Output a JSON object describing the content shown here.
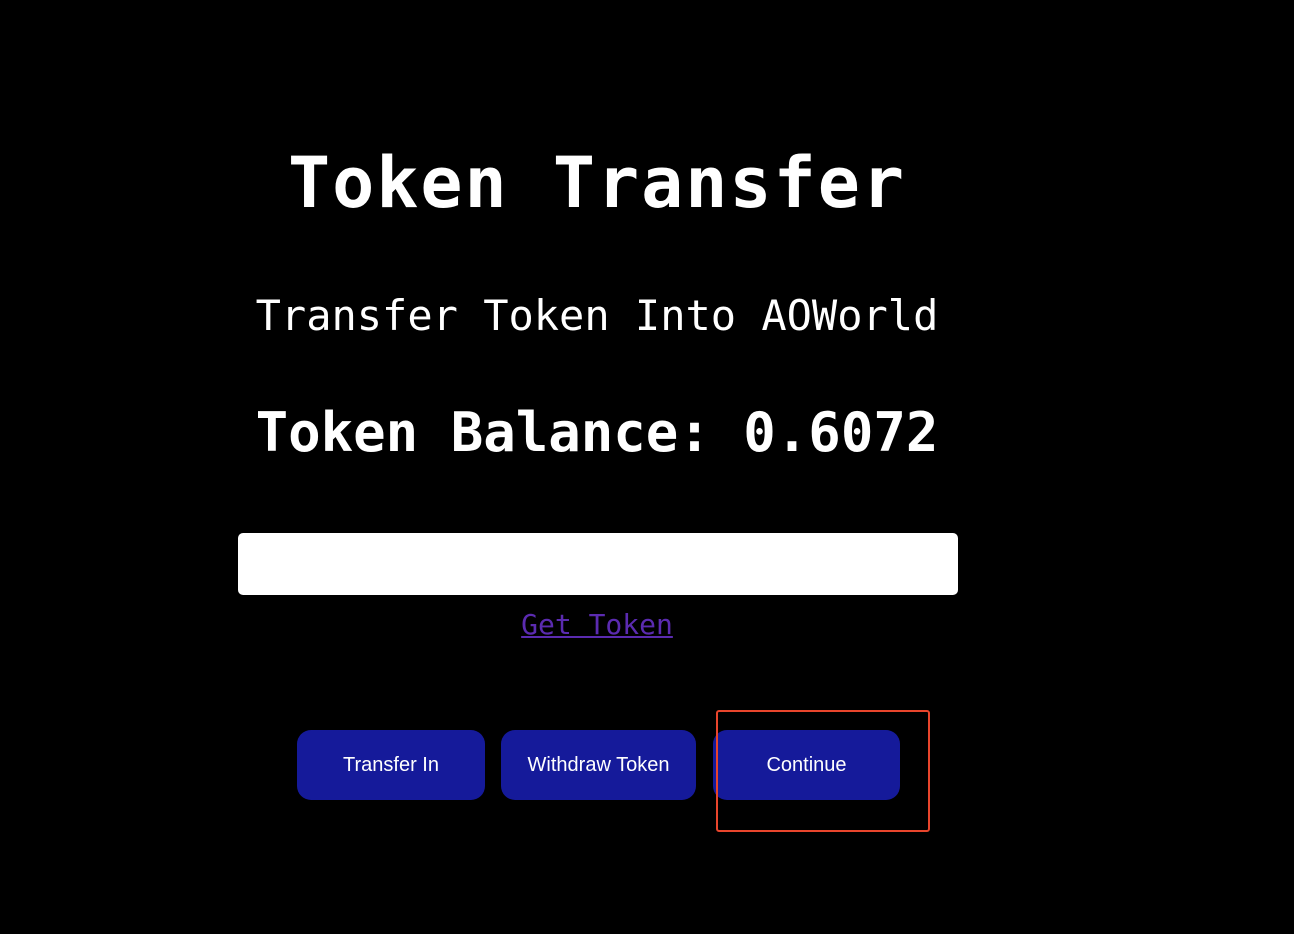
{
  "page": {
    "title": "Token Transfer",
    "subtitle": "Transfer Token Into AOWorld",
    "balance_text": "Token Balance: 0.6072"
  },
  "form": {
    "amount_value": "",
    "amount_placeholder": "",
    "get_token_link": "Get Token"
  },
  "buttons": {
    "transfer_in": "Transfer In",
    "withdraw_token": "Withdraw Token",
    "continue": "Continue"
  },
  "colors": {
    "background": "#000000",
    "button": "#151a9a",
    "link": "#5b2bb0",
    "highlight": "#e8452c"
  }
}
